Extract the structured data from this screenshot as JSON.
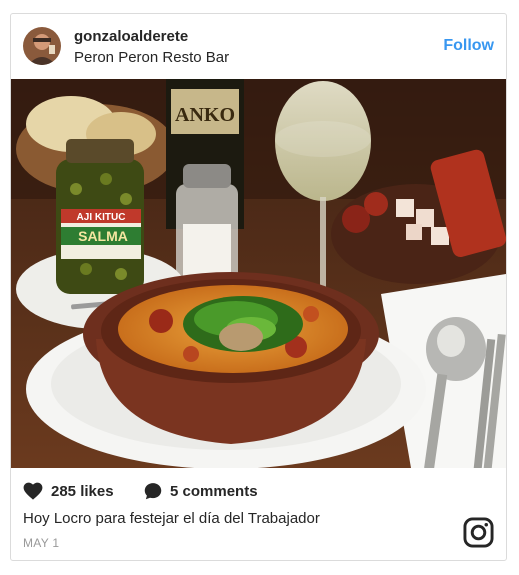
{
  "post": {
    "username": "gonzaloalderete",
    "location": "Peron Peron Resto Bar",
    "follow_label": "Follow",
    "likes_label": "285 likes",
    "comments_label": "5 comments",
    "caption": "Hoy Locro para festejar el día del Trabajador",
    "date": "MAY 1"
  },
  "photo": {
    "jar_label_top": "AJI KITUC",
    "jar_label_main": "SALMA",
    "bottle_label": "ANKO"
  },
  "icons": {
    "likes": "heart-icon",
    "comments": "speech-bubble-icon",
    "brand": "instagram-icon"
  },
  "colors": {
    "follow": "#3897f0",
    "text": "#262626",
    "date": "#999999"
  }
}
